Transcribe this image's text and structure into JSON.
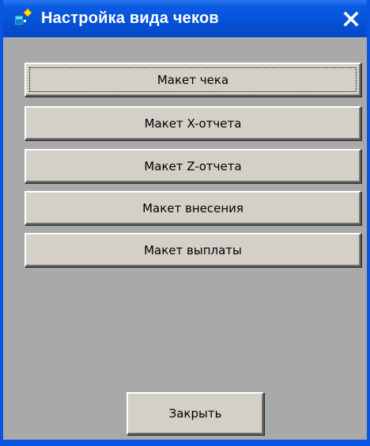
{
  "window": {
    "title": "Настройка вида чеков",
    "title_icon": "app-settings-icon",
    "close_icon": "close-x-icon",
    "title_bar_color": "#0a55e0",
    "body_color": "#a9a9a9"
  },
  "buttons": [
    {
      "label": "Макет чека",
      "focused": true
    },
    {
      "label": "Макет X-отчета",
      "focused": false
    },
    {
      "label": "Макет Z-отчета",
      "focused": false
    },
    {
      "label": "Макет внесения",
      "focused": false
    },
    {
      "label": "Макет выплаты",
      "focused": false
    }
  ],
  "footer": {
    "close_label": "Закрыть"
  }
}
